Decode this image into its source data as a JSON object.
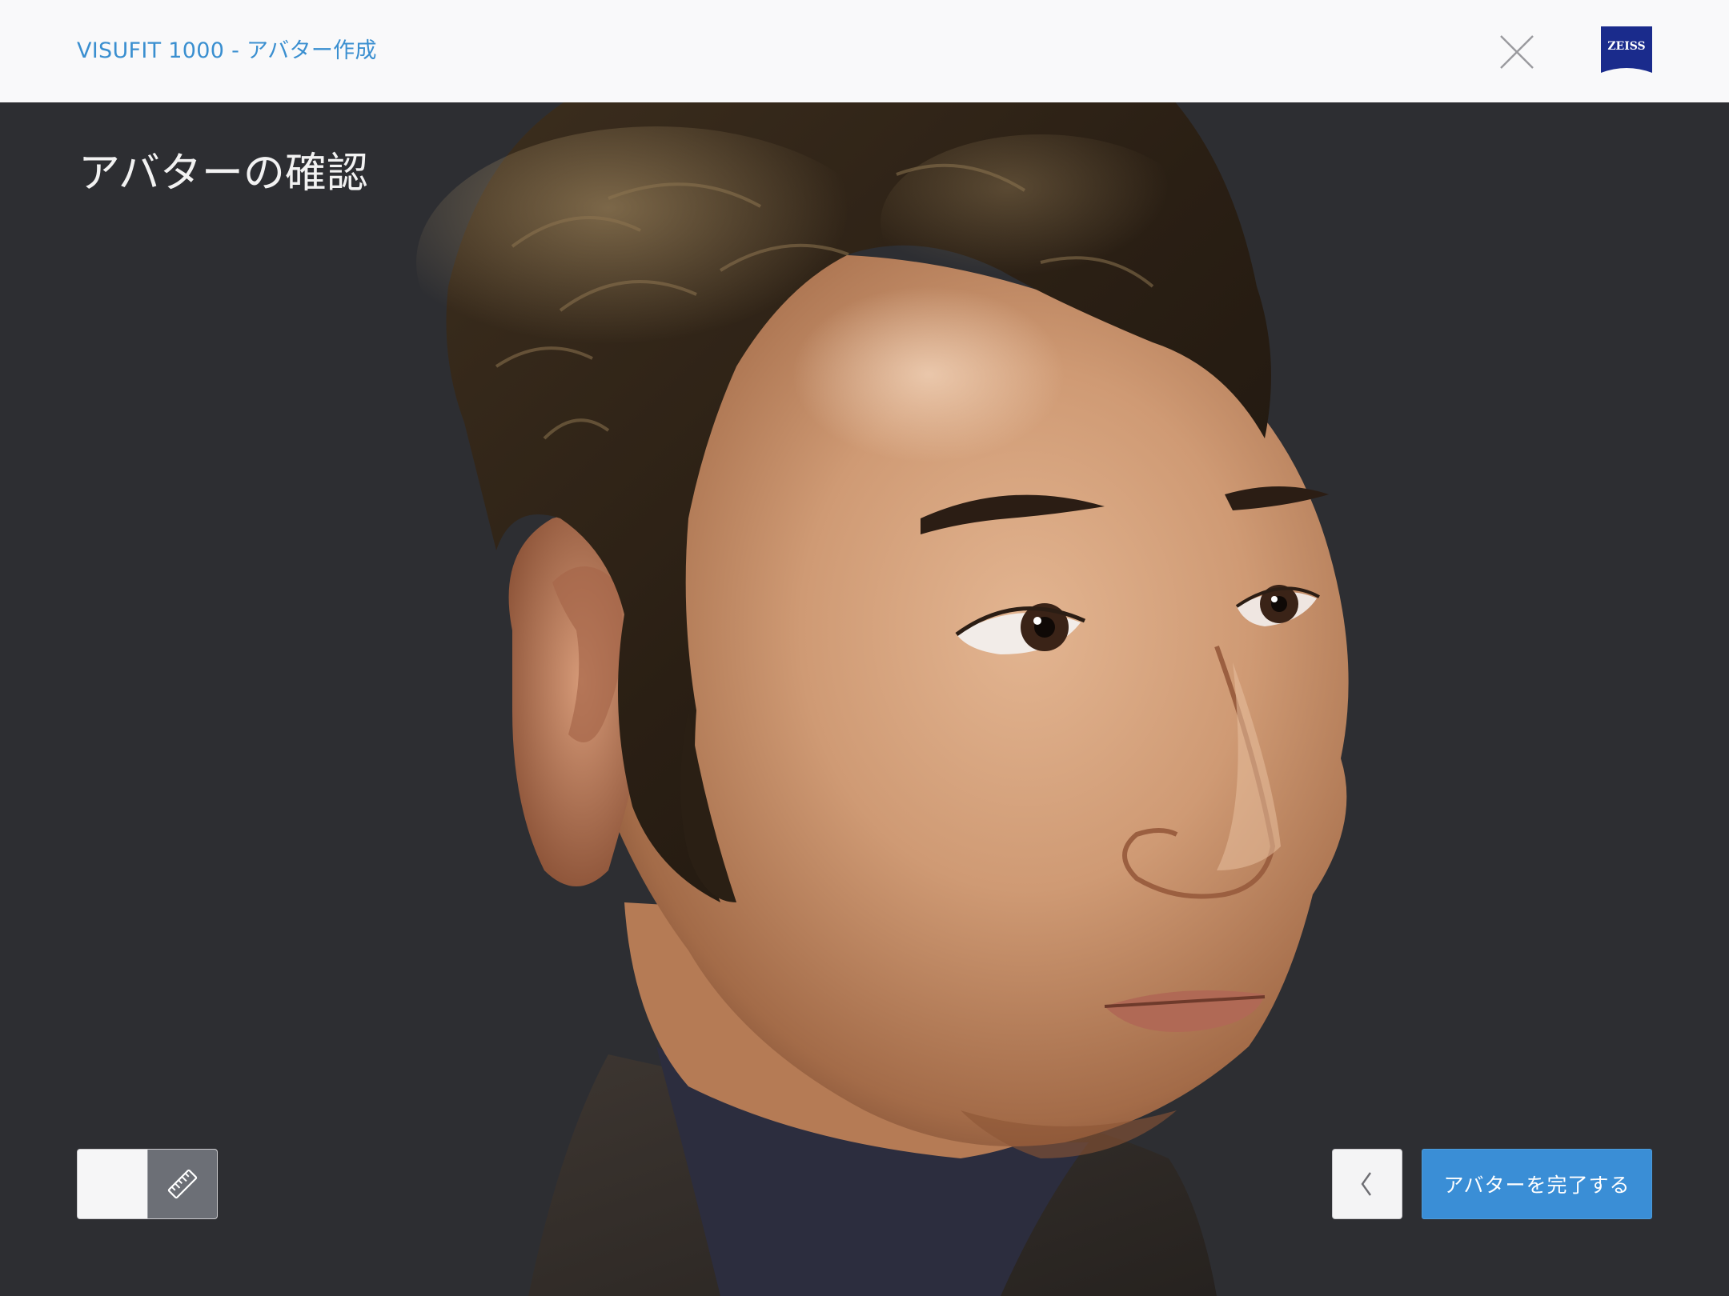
{
  "header": {
    "app_title": "VISUFIT 1000 - アバター作成",
    "close_icon": "close-icon",
    "logo_text": "ZEISS"
  },
  "main": {
    "page_title": "アバターの確認",
    "avatar_image": "3d-head-avatar"
  },
  "view_toggle": {
    "texture_icon": "texture-view-icon",
    "measure_icon": "ruler-icon",
    "active": "measure"
  },
  "footer": {
    "back_icon": "chevron-left-icon",
    "complete_label": "アバターを完了する"
  },
  "colors": {
    "accent": "#3a8ed6",
    "background": "#2d2e32",
    "header_bg": "#f9f9fa",
    "title_text": "#3a8fd0",
    "logo_blue": "#1a2b8c"
  }
}
